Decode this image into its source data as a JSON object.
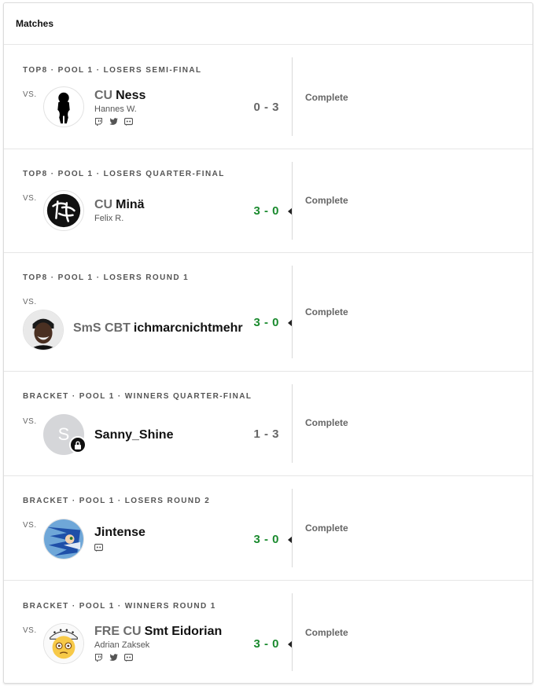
{
  "header": {
    "title": "Matches"
  },
  "matches": [
    {
      "round": "TOP8 · POOL 1 · LOSERS SEMI-FINAL",
      "vs": "VS.",
      "prefix": "CU",
      "name": "Ness",
      "real_name": "Hannes W.",
      "socials": [
        "twitch-icon",
        "twitter-icon",
        "discord-icon"
      ],
      "score": "0 - 3",
      "won": false,
      "status": "Complete",
      "avatar_icon": "silhouette-avatar"
    },
    {
      "round": "TOP8 · POOL 1 · LOSERS QUARTER-FINAL",
      "vs": "VS.",
      "prefix": "CU",
      "name": "Minä",
      "real_name": "Felix R.",
      "socials": [],
      "score": "3 - 0",
      "won": true,
      "status": "Complete",
      "avatar_icon": "kanji-brush-avatar"
    },
    {
      "round": "TOP8 · POOL 1 · LOSERS ROUND 1",
      "vs": "VS.",
      "prefix": "SmS CBT",
      "name": "ichmarcnichtmehr",
      "real_name": "",
      "socials": [],
      "score": "3 - 0",
      "won": true,
      "status": "Complete",
      "avatar_icon": "photo-avatar"
    },
    {
      "round": "BRACKET · POOL 1 · WINNERS QUARTER-FINAL",
      "vs": "VS.",
      "prefix": "",
      "name": "Sanny_Shine",
      "real_name": "",
      "socials": [],
      "score": "1 - 3",
      "won": false,
      "status": "Complete",
      "avatar_icon": "letter-avatar",
      "avatar_letter": "S"
    },
    {
      "round": "BRACKET · POOL 1 · LOSERS ROUND 2",
      "vs": "VS.",
      "prefix": "",
      "name": "Jintense",
      "real_name": "",
      "socials": [
        "discord-icon"
      ],
      "score": "3 - 0",
      "won": true,
      "status": "Complete",
      "avatar_icon": "sonic-avatar"
    },
    {
      "round": "BRACKET · POOL 1 · WINNERS ROUND 1",
      "vs": "VS.",
      "prefix": "FRE CU",
      "name": "Smt Eidorian",
      "real_name": "Adrian Zaksek",
      "socials": [
        "twitch-icon",
        "twitter-icon",
        "discord-icon"
      ],
      "score": "3 - 0",
      "won": true,
      "status": "Complete",
      "avatar_icon": "emoji-avatar"
    }
  ],
  "colors": {
    "win": "#1a8a2e",
    "loss": "#666666",
    "divider": "#d9d9d9"
  }
}
